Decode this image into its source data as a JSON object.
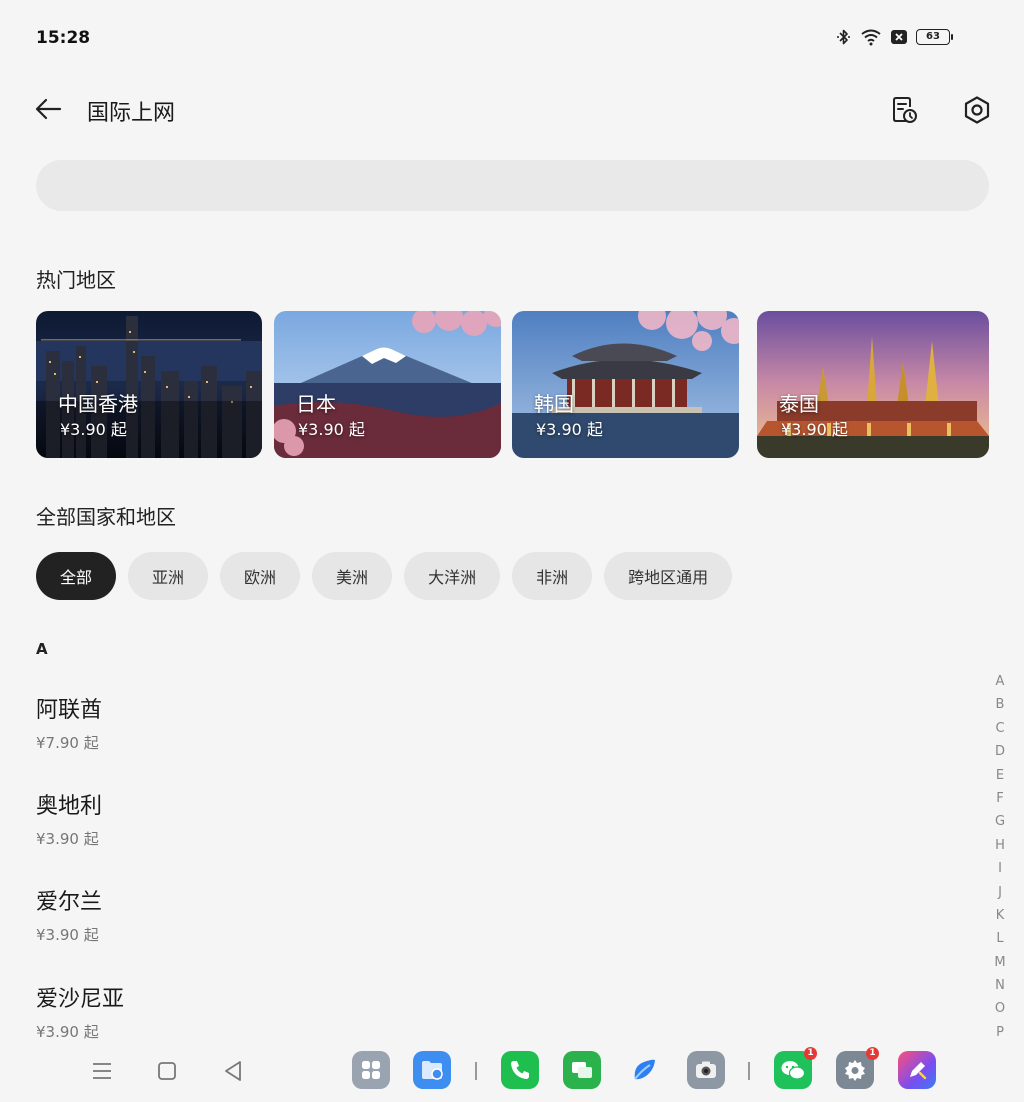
{
  "status_bar": {
    "time": "15:28",
    "battery": "63"
  },
  "header": {
    "title": "国际上网"
  },
  "hot_regions": {
    "title": "热门地区",
    "items": [
      {
        "name": "中国香港",
        "price": "¥3.90 起"
      },
      {
        "name": "日本",
        "price": "¥3.90 起"
      },
      {
        "name": "韩国",
        "price": "¥3.90 起"
      },
      {
        "name": "泰国",
        "price": "¥3.90 起"
      }
    ]
  },
  "all_regions": {
    "title": "全部国家和地区",
    "filters": [
      "全部",
      "亚洲",
      "欧洲",
      "美洲",
      "大洋洲",
      "非洲",
      "跨地区通用"
    ],
    "active_filter": "全部"
  },
  "country_list": {
    "section_letter": "A",
    "items": [
      {
        "name": "阿联酋",
        "price": "¥7.90 起"
      },
      {
        "name": "奥地利",
        "price": "¥3.90 起"
      },
      {
        "name": "爱尔兰",
        "price": "¥3.90 起"
      },
      {
        "name": "爱沙尼亚",
        "price": "¥3.90 起"
      }
    ]
  },
  "alphabet_index": [
    "A",
    "B",
    "C",
    "D",
    "E",
    "F",
    "G",
    "H",
    "I",
    "J",
    "K",
    "L",
    "M",
    "N",
    "O",
    "P"
  ],
  "dock": {
    "badges": {
      "wechat": "1",
      "settings": "1"
    }
  },
  "colors": {
    "active_chip": "#222222",
    "chip": "#e6e6e6",
    "background": "#f5f5f5"
  }
}
